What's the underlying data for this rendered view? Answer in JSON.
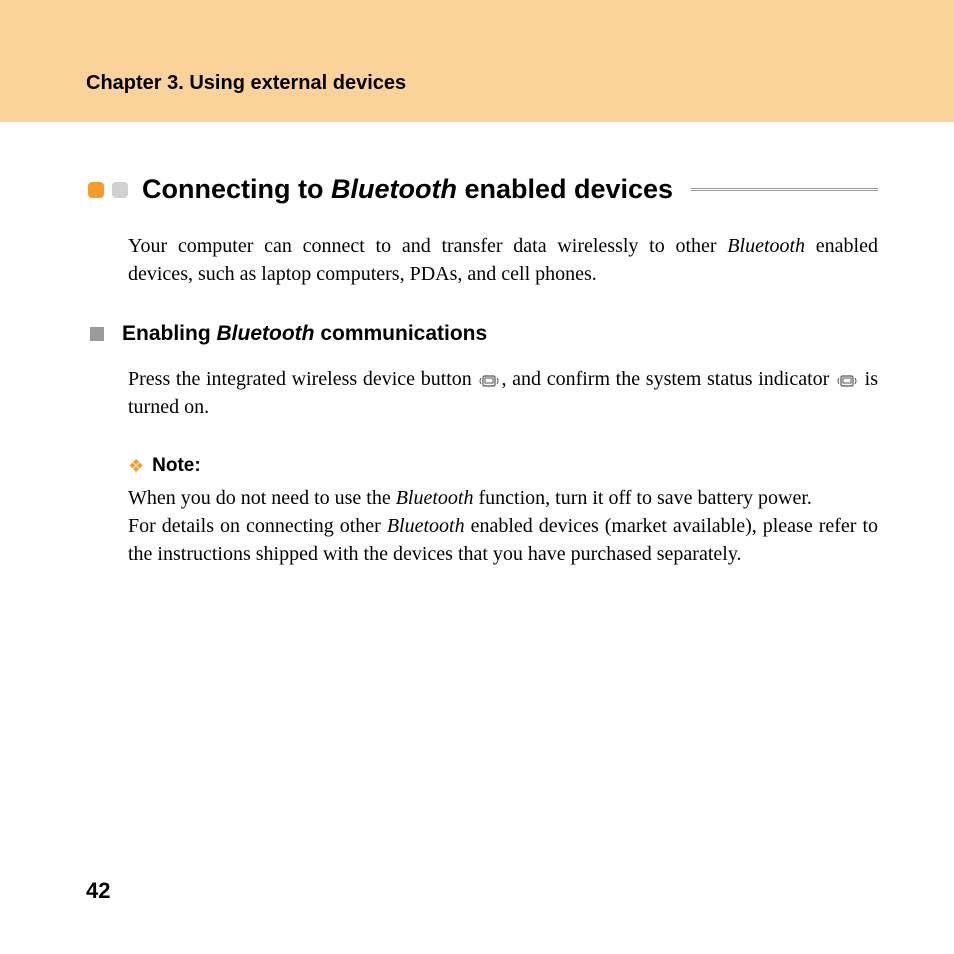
{
  "header": {
    "chapter": "Chapter 3. Using external devices"
  },
  "section": {
    "title_pre": "Connecting to ",
    "title_it": "Bluetooth",
    "title_post": " enabled devices"
  },
  "intro": {
    "p1a": "Your computer can connect to and transfer data wirelessly to other ",
    "p1b": "Bluetooth",
    "p1c": " enabled devices, such as laptop computers, PDAs, and cell phones."
  },
  "subsection": {
    "title_pre": "Enabling ",
    "title_it": "Bluetooth",
    "title_post": " communications",
    "body_a": "Press the integrated wireless device button ",
    "body_b": ", and confirm the system status indicator ",
    "body_c": " is turned on."
  },
  "note": {
    "label": "Note:",
    "p1a": "When you do not need to use the ",
    "p1b": "Bluetooth",
    "p1c": " function, turn it off to save battery power.",
    "p2a": "For details on connecting other ",
    "p2b": "Bluetooth",
    "p2c": " enabled devices (market available), please refer to the instructions shipped with the devices that you have purchased separately."
  },
  "page_number": "42"
}
